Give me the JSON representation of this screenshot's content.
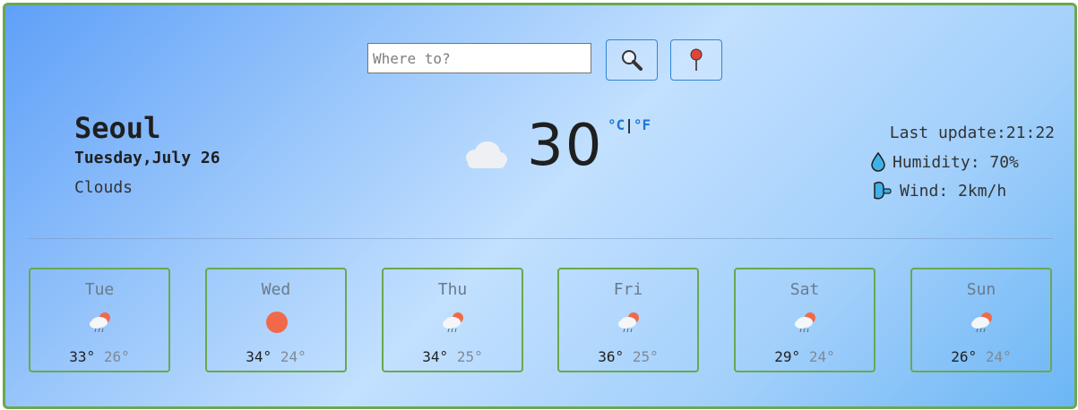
{
  "search": {
    "placeholder": "Where to?"
  },
  "current": {
    "city": "Seoul",
    "date": "Tuesday,July 26",
    "description": "Clouds",
    "temperature": "30",
    "unit_c": "°C",
    "unit_sep": "|",
    "unit_f": "°F",
    "icon": "cloud-icon",
    "last_update": "Last update:21:22",
    "humidity": "Humidity: 70%",
    "wind": "Wind: 2km/h"
  },
  "forecast": [
    {
      "day": "Tue",
      "max": "33°",
      "min": "26°",
      "icon": "cloud-sun-rain-icon"
    },
    {
      "day": "Wed",
      "max": "34°",
      "min": "24°",
      "icon": "sun-icon"
    },
    {
      "day": "Thu",
      "max": "34°",
      "min": "25°",
      "icon": "cloud-sun-rain-icon"
    },
    {
      "day": "Fri",
      "max": "36°",
      "min": "25°",
      "icon": "cloud-sun-rain-icon"
    },
    {
      "day": "Sat",
      "max": "29°",
      "min": "24°",
      "icon": "cloud-sun-rain-icon"
    },
    {
      "day": "Sun",
      "max": "26°",
      "min": "24°",
      "icon": "cloud-sun-rain-icon"
    }
  ],
  "colors": {
    "border": "#6aa84f",
    "accent": "#1f76d2",
    "sun": "#f06a4a"
  }
}
